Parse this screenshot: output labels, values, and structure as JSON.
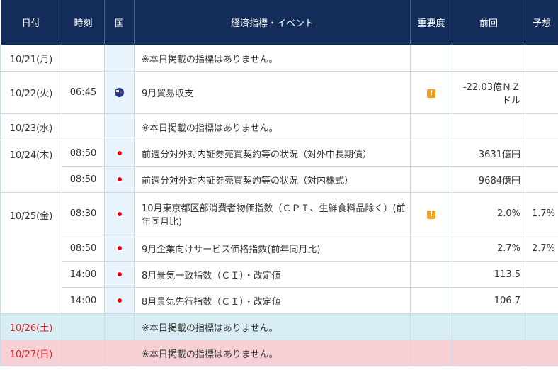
{
  "header": {
    "date": "日付",
    "time": "時刻",
    "country": "国",
    "event": "経済指標・イベント",
    "importance": "重要度",
    "previous": "前回",
    "forecast": "予想"
  },
  "no_event_text": "※本日掲載の指標はありません。",
  "rows": [
    {
      "date": "10/21(月)",
      "time": "",
      "country": "",
      "event": "※本日掲載の指標はありません。",
      "importance": "",
      "previous": "",
      "forecast": ""
    },
    {
      "date": "10/22(火)",
      "time": "06:45",
      "country": "nz-flag-icon",
      "event": "9月貿易収支",
      "importance": "warning-icon",
      "previous": "-22.03億ＮＺドル",
      "forecast": ""
    },
    {
      "date": "10/23(水)",
      "time": "",
      "country": "",
      "event": "※本日掲載の指標はありません。",
      "importance": "",
      "previous": "",
      "forecast": ""
    },
    {
      "date": "10/24(木)",
      "time": "08:50",
      "country": "jp-flag-icon",
      "event": "前週分対外対内証券売買契約等の状況（対外中長期債）",
      "importance": "",
      "previous": "-3631億円",
      "forecast": ""
    },
    {
      "date": "",
      "time": "08:50",
      "country": "jp-flag-icon",
      "event": "前週分対外対内証券売買契約等の状況（対内株式）",
      "importance": "",
      "previous": "9684億円",
      "forecast": ""
    },
    {
      "date": "10/25(金)",
      "time": "08:30",
      "country": "jp-flag-icon",
      "event": "10月東京都区部消費者物価指数（ＣＰＩ、生鮮食料品除く）(前年同月比)",
      "importance": "warning-icon",
      "previous": "2.0%",
      "forecast": "1.7%"
    },
    {
      "date": "",
      "time": "08:50",
      "country": "jp-flag-icon",
      "event": "9月企業向けサービス価格指数(前年同月比)",
      "importance": "",
      "previous": "2.7%",
      "forecast": "2.7%"
    },
    {
      "date": "",
      "time": "14:00",
      "country": "jp-flag-icon",
      "event": "8月景気一致指数（ＣＩ）・改定値",
      "importance": "",
      "previous": "113.5",
      "forecast": ""
    },
    {
      "date": "",
      "time": "14:00",
      "country": "jp-flag-icon",
      "event": "8月景気先行指数（ＣＩ）・改定値",
      "importance": "",
      "previous": "106.7",
      "forecast": ""
    },
    {
      "date": "10/26(土)",
      "time": "",
      "country": "",
      "event": "※本日掲載の指標はありません。",
      "importance": "",
      "previous": "",
      "forecast": ""
    },
    {
      "date": "10/27(日)",
      "time": "",
      "country": "",
      "event": "※本日掲載の指標はありません。",
      "importance": "",
      "previous": "",
      "forecast": ""
    }
  ],
  "colors": {
    "header_bg": "#132c5a",
    "border": "#c7dae6",
    "flag_col_bg": "#e9f3fb",
    "saturday_bg": "#d8eef4",
    "sunday_bg": "#f6d0d4",
    "weekend_date": "#e21f1f",
    "importance_icon": "#f0a020"
  }
}
